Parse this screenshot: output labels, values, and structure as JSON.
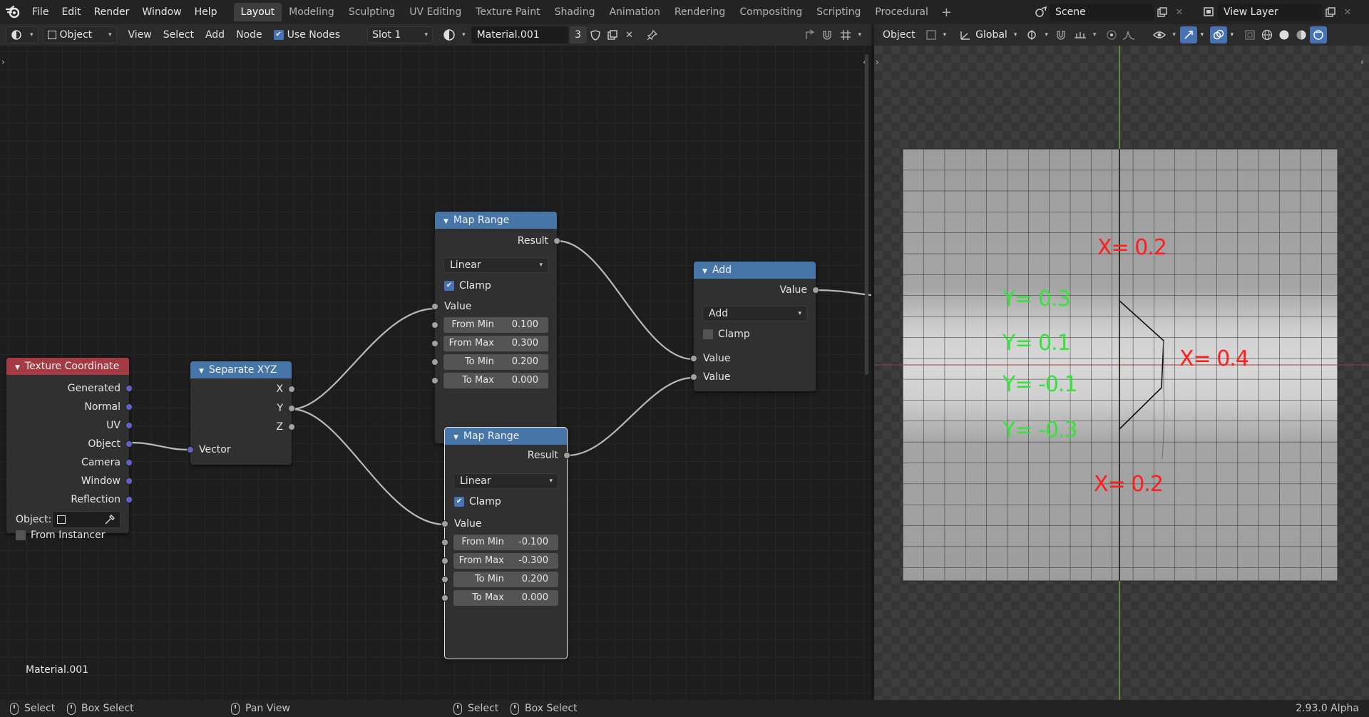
{
  "menu": [
    "File",
    "Edit",
    "Render",
    "Window",
    "Help"
  ],
  "workspaces": [
    "Layout",
    "Modeling",
    "Sculpting",
    "UV Editing",
    "Texture Paint",
    "Shading",
    "Animation",
    "Rendering",
    "Compositing",
    "Scripting",
    "Procedural"
  ],
  "active_workspace": "Layout",
  "scene": "Scene",
  "view_layer": "View Layer",
  "node_header": {
    "mode": "Object",
    "view": "View",
    "select": "Select",
    "add": "Add",
    "node": "Node",
    "use_nodes": "Use Nodes",
    "slot": "Slot 1",
    "material": "Material.001",
    "users": "3"
  },
  "viewport_header": {
    "object": "Object",
    "orientation": "Global"
  },
  "nodes": {
    "texcoord": {
      "title": "Texture Coordinate",
      "outputs": [
        "Generated",
        "Normal",
        "UV",
        "Object",
        "Camera",
        "Window",
        "Reflection"
      ],
      "object_label": "Object:",
      "from_instancer": "From Instancer"
    },
    "sepxyz": {
      "title": "Separate XYZ",
      "outputs": [
        "X",
        "Y",
        "Z"
      ],
      "input": "Vector"
    },
    "maprange1": {
      "title": "Map Range",
      "output": "Result",
      "interp": "Linear",
      "clamp": "Clamp",
      "value": "Value",
      "fields": [
        {
          "label": "From Min",
          "value": "0.100"
        },
        {
          "label": "From Max",
          "value": "0.300"
        },
        {
          "label": "To Min",
          "value": "0.200"
        },
        {
          "label": "To Max",
          "value": "0.000"
        }
      ]
    },
    "maprange2": {
      "title": "Map Range",
      "output": "Result",
      "interp": "Linear",
      "clamp": "Clamp",
      "value": "Value",
      "fields": [
        {
          "label": "From Min",
          "value": "-0.100"
        },
        {
          "label": "From Max",
          "value": "-0.300"
        },
        {
          "label": "To Min",
          "value": "0.200"
        },
        {
          "label": "To Max",
          "value": "0.000"
        }
      ]
    },
    "add": {
      "title": "Add",
      "output": "Value",
      "op": "Add",
      "clamp": "Clamp",
      "inputs": [
        "Value",
        "Value"
      ]
    }
  },
  "material_label": "Material.001",
  "annotations": {
    "red": [
      "X= 0.2",
      "X= 0.4",
      "X= 0.2"
    ],
    "green": [
      "Y= 0.3",
      "Y= 0.1",
      "Y= -0.1",
      "Y= -0.3"
    ]
  },
  "status": {
    "select": "Select",
    "box_select": "Box Select",
    "pan_view": "Pan View",
    "select2": "Select",
    "box_select2": "Box Select",
    "version": "2.93.0 Alpha"
  },
  "colors": {
    "texcoord_header": "#a33a44",
    "vector_header": "#4675a7",
    "annotation_red": "#ff1d1d",
    "annotation_green": "#35e43a"
  }
}
